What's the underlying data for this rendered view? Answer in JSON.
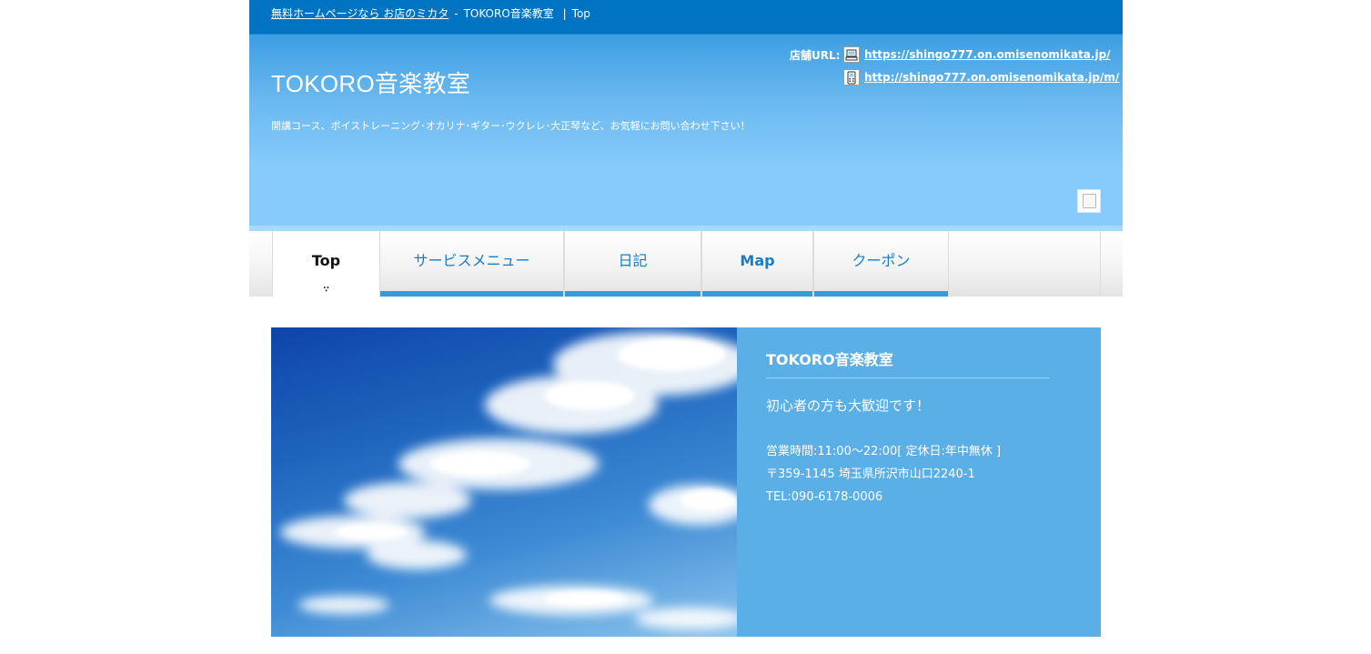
{
  "breadcrumb": {
    "link_text": "無料ホームページなら お店のミカタ",
    "separator": "-",
    "shop": "TOKORO音楽教室",
    "divider": "|",
    "page": "Top"
  },
  "header": {
    "title": "TOKORO音楽教室",
    "tagline": "開講コース、ボイストレーニング･オカリナ･ギター･ウクレレ･大正琴など、お気軽にお問い合わせ下さい！",
    "url_label": "店舗URL:",
    "urls": [
      {
        "icon": "computer-icon",
        "text": "https://shingo777.on.omisenomikata.jp/"
      },
      {
        "icon": "mobile-phone-icon",
        "text": "http://shingo777.on.omisenomikata.jp/m/"
      }
    ]
  },
  "nav": {
    "items": [
      {
        "label": "Top",
        "active": true
      },
      {
        "label": "サービスメニュー"
      },
      {
        "label": "日記"
      },
      {
        "label": "Map"
      },
      {
        "label": "クーポン"
      }
    ],
    "active_marker": "∵"
  },
  "hero": {
    "image": "blue-sky-clouds",
    "title": "TOKORO音楽教室",
    "lead": "初心者の方も大歓迎です！",
    "hours": "営業時間:11:00～22:00[ 定休日:年中無休 ]",
    "address": "〒359-1145 埼玉県所沢市山口2240-1",
    "tel": "TEL:090-6178-0006"
  },
  "colors": {
    "topbar": "#0074c3",
    "nav_text": "#1b7cc6",
    "nav_bar": "#3a9ad9",
    "panel": "#5aafe6"
  }
}
